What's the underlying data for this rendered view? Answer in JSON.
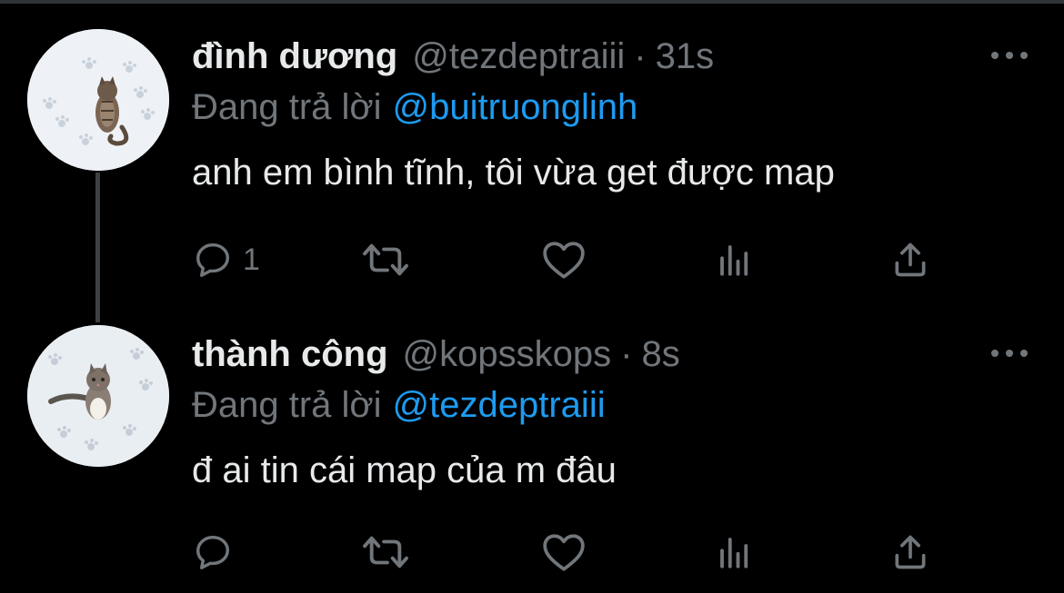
{
  "thread": {
    "tweets": [
      {
        "display_name": "đình dương",
        "handle": "@tezdeptraiii",
        "separator": "·",
        "time": "31s",
        "replying_label": "Đang trả lời",
        "replying_to": "@buitruonglinh",
        "text": "anh em bình tĩnh, tôi vừa get được map",
        "reply_count": "1",
        "avatar_icon": "cat-in-snow-avatar-icon"
      },
      {
        "display_name": "thành công",
        "handle": "@kopsskops",
        "separator": "·",
        "time": "8s",
        "replying_label": "Đang trả lời",
        "replying_to": "@tezdeptraiii",
        "text": "đ ai tin cái map của m đâu",
        "reply_count": "",
        "avatar_icon": "cat-in-snow-avatar-icon"
      }
    ]
  },
  "colors": {
    "background": "#000000",
    "primary_text": "#e7e9ea",
    "secondary_text": "#71767b",
    "link": "#1d9bf0",
    "thread_line": "#3e4144"
  },
  "icons": {
    "reply": "reply-icon",
    "retweet": "retweet-icon",
    "like": "heart-icon",
    "views": "views-bar-chart-icon",
    "share": "share-icon",
    "more": "more-dots-icon"
  }
}
